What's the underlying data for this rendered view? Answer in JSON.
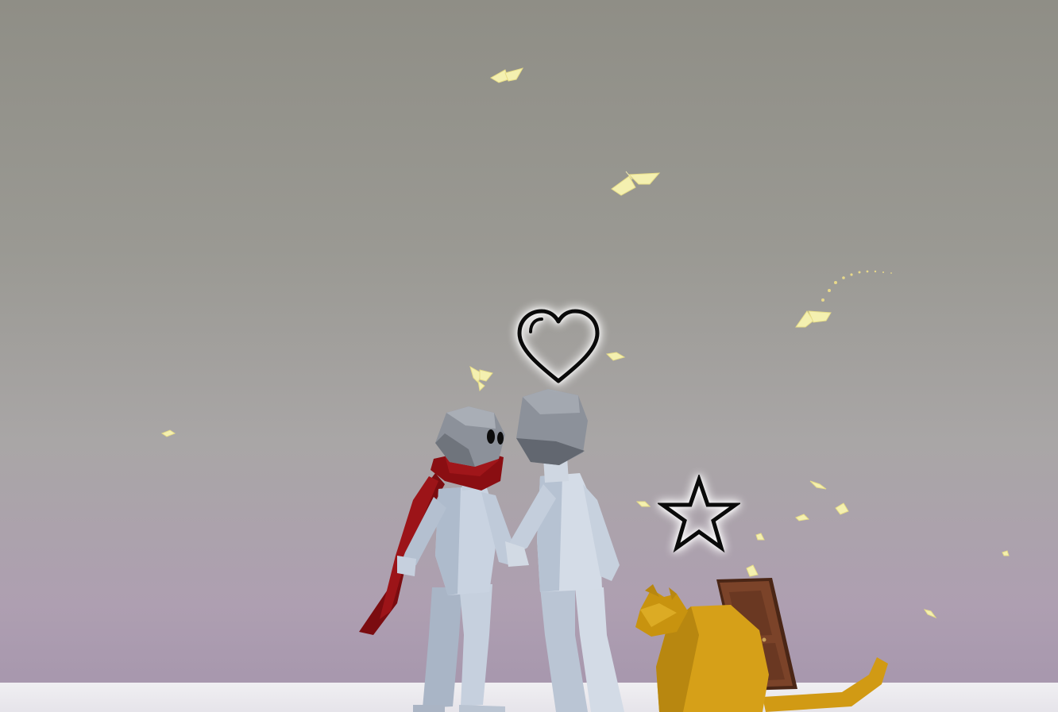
{
  "scene": {
    "sky_top_color": "#8f8e86",
    "sky_bottom_color": "#ae9fb1",
    "floor_color": "#f0eff2",
    "butterfly_color": "#f4f0b0",
    "heart_icon": "heart-outline-icon",
    "star_icon": "star-outline-icon",
    "characters": [
      {
        "name": "scarf-character",
        "scarf_color": "#8e1014",
        "body_color": "#b9c4d4"
      },
      {
        "name": "partner-character",
        "body_color": "#b9c4d4"
      },
      {
        "name": "cat",
        "body_color": "#d6a018"
      }
    ],
    "objects": [
      {
        "name": "wooden-door",
        "color": "#6b3a24"
      }
    ]
  }
}
